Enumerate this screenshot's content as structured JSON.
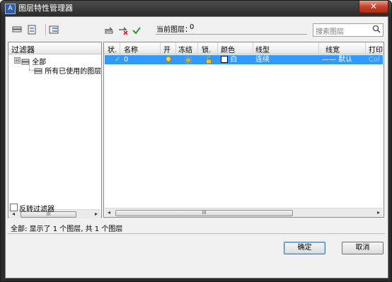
{
  "window": {
    "title": "图层特性管理器",
    "close_glyph": "✕"
  },
  "toolbar": {
    "left_icons": [
      "new-filter-icon",
      "group-filter-icon",
      "state-manager-icon"
    ],
    "layer_icons": [
      "new-layer-icon",
      "delete-layer-icon",
      "set-current-icon"
    ],
    "current_layer_label": "当前图层：",
    "current_layer_value": "0",
    "search_placeholder": "搜索图层"
  },
  "filter_panel": {
    "header": "过滤器",
    "tree": [
      {
        "label": "全部",
        "expander": "⊟"
      },
      {
        "label": "所有已使用的图层"
      }
    ],
    "invert_label": "反转过滤器"
  },
  "layer_grid": {
    "columns": [
      "状.",
      "名称",
      "开",
      "冻结",
      "锁.",
      "颜色",
      "线型",
      "线宽",
      "打印"
    ],
    "rows": [
      {
        "status": "✓",
        "name": "0",
        "on": "on",
        "freeze": "thawed",
        "lock": "unlocked",
        "color": "白",
        "linetype": "连续",
        "lineweight": "—— 默认",
        "plot": "Col"
      }
    ]
  },
  "status_bar": {
    "text": "全部:   显示了 1 个图层, 共 1 个图层"
  },
  "buttons": {
    "ok": "确定",
    "cancel": "取消"
  },
  "scrollbars": {
    "grip": "III",
    "left_arrow": "◂",
    "right_arrow": "▸"
  },
  "colors": {
    "selection": "#3399ff",
    "title_text": "#ffffff",
    "close": "#c7402a"
  }
}
